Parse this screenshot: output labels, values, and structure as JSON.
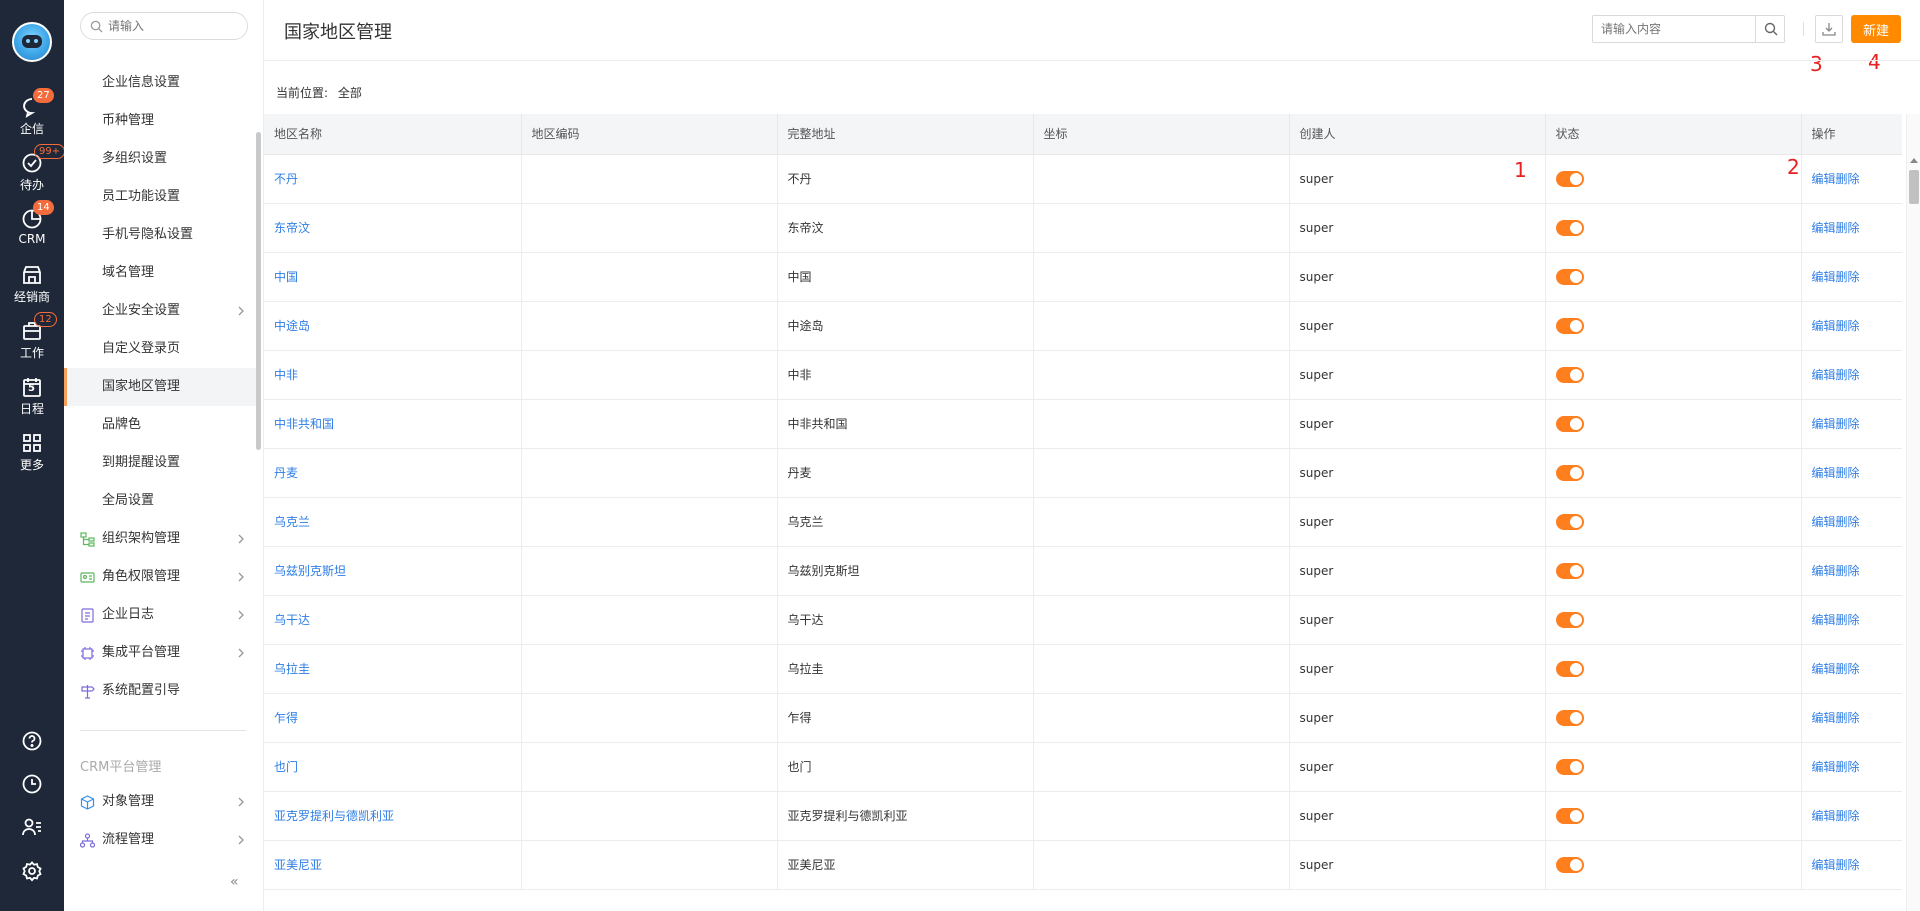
{
  "rail": {
    "items": [
      {
        "label": "企信",
        "badge": "27"
      },
      {
        "label": "待办",
        "badge": "99+"
      },
      {
        "label": "CRM",
        "badge": "14"
      },
      {
        "label": "经销商",
        "badge": ""
      },
      {
        "label": "工作",
        "badge": "12"
      },
      {
        "label": "日程",
        "badge": "",
        "day": "5"
      },
      {
        "label": "更多",
        "badge": ""
      }
    ]
  },
  "sidebar": {
    "search_placeholder": "请输入",
    "items": [
      "企业信息设置",
      "币种管理",
      "多组织设置",
      "员工功能设置",
      "手机号隐私设置",
      "域名管理",
      "企业安全设置",
      "自定义登录页",
      "国家地区管理",
      "品牌色",
      "到期提醒设置",
      "全局设置"
    ],
    "groups": [
      "组织架构管理",
      "角色权限管理",
      "企业日志",
      "集成平台管理",
      "系统配置引导"
    ],
    "section_title": "CRM平台管理",
    "crm_groups": [
      "对象管理",
      "流程管理"
    ],
    "collapse": "«"
  },
  "header": {
    "title": "国家地区管理",
    "search_placeholder": "请输入内容",
    "new_label": "新建"
  },
  "annotations": [
    "1",
    "2",
    "3",
    "4"
  ],
  "location": {
    "label": "当前位置:",
    "value": "全部"
  },
  "table": {
    "columns": [
      "地区名称",
      "地区编码",
      "完整地址",
      "坐标",
      "创建人",
      "状态",
      "操作"
    ],
    "rows": [
      {
        "name": "不丹",
        "code": "",
        "address": "不丹",
        "coord": "",
        "creator": "super"
      },
      {
        "name": "东帝汶",
        "code": "",
        "address": "东帝汶",
        "coord": "",
        "creator": "super"
      },
      {
        "name": "中国",
        "code": "",
        "address": "中国",
        "coord": "",
        "creator": "super"
      },
      {
        "name": "中途岛",
        "code": "",
        "address": "中途岛",
        "coord": "",
        "creator": "super"
      },
      {
        "name": "中非",
        "code": "",
        "address": "中非",
        "coord": "",
        "creator": "super"
      },
      {
        "name": "中非共和国",
        "code": "",
        "address": "中非共和国",
        "coord": "",
        "creator": "super"
      },
      {
        "name": "丹麦",
        "code": "",
        "address": "丹麦",
        "coord": "",
        "creator": "super"
      },
      {
        "name": "乌克兰",
        "code": "",
        "address": "乌克兰",
        "coord": "",
        "creator": "super"
      },
      {
        "name": "乌兹别克斯坦",
        "code": "",
        "address": "乌兹别克斯坦",
        "coord": "",
        "creator": "super"
      },
      {
        "name": "乌干达",
        "code": "",
        "address": "乌干达",
        "coord": "",
        "creator": "super"
      },
      {
        "name": "乌拉圭",
        "code": "",
        "address": "乌拉圭",
        "coord": "",
        "creator": "super"
      },
      {
        "name": "乍得",
        "code": "",
        "address": "乍得",
        "coord": "",
        "creator": "super"
      },
      {
        "name": "也门",
        "code": "",
        "address": "也门",
        "coord": "",
        "creator": "super"
      },
      {
        "name": "亚克罗提利与德凯利亚",
        "code": "",
        "address": "亚克罗提利与德凯利亚",
        "coord": "",
        "creator": "super"
      },
      {
        "name": "亚美尼亚",
        "code": "",
        "address": "亚美尼亚",
        "coord": "",
        "creator": "super"
      }
    ],
    "edit_label": "编辑",
    "delete_label": "删除"
  },
  "colors": {
    "accent": "#ff8a00",
    "link": "#2f7ee6",
    "rail": "#1f2838",
    "annotation": "#e82020"
  }
}
